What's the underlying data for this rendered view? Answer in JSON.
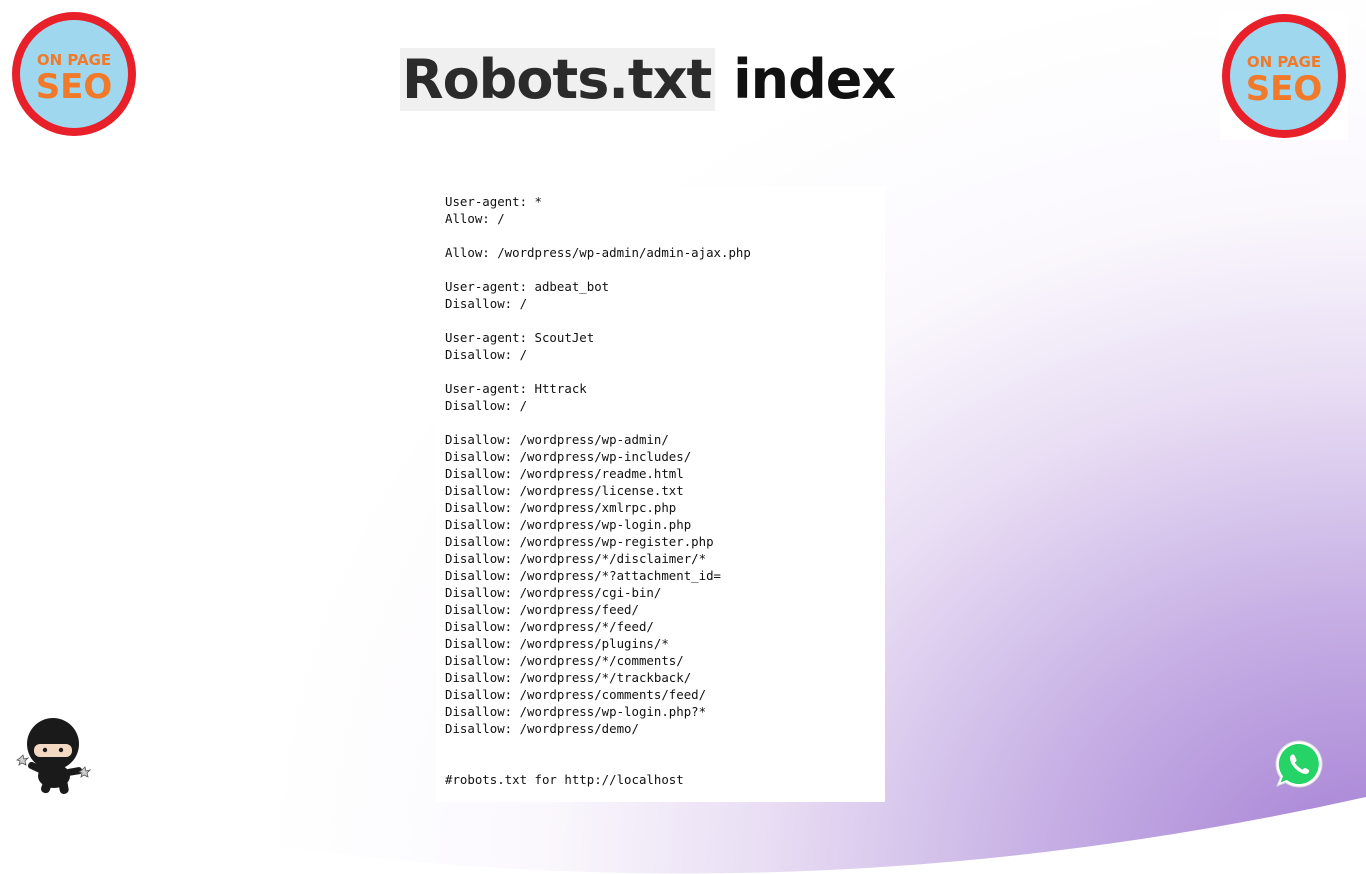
{
  "header": {
    "title_highlight": "Robots.txt",
    "title_rest": "index"
  },
  "logo": {
    "top_text": "ON PAGE",
    "bottom_text": "SEO",
    "ring_color": "#e8202a",
    "inner_color": "#9fd8ee",
    "text_color": "#f07a2a"
  },
  "robots_txt": {
    "lines": [
      "User-agent: *",
      "Allow: /",
      "",
      "Allow: /wordpress/wp-admin/admin-ajax.php",
      "",
      "User-agent: adbeat_bot",
      "Disallow: /",
      "",
      "User-agent: ScoutJet",
      "Disallow: /",
      "",
      "User-agent: Httrack",
      "Disallow: /",
      "",
      "Disallow: /wordpress/wp-admin/",
      "Disallow: /wordpress/wp-includes/",
      "Disallow: /wordpress/readme.html",
      "Disallow: /wordpress/license.txt",
      "Disallow: /wordpress/xmlrpc.php",
      "Disallow: /wordpress/wp-login.php",
      "Disallow: /wordpress/wp-register.php",
      "Disallow: /wordpress/*/disclaimer/*",
      "Disallow: /wordpress/*?attachment_id=",
      "Disallow: /wordpress/cgi-bin/",
      "Disallow: /wordpress/feed/",
      "Disallow: /wordpress/*/feed/",
      "Disallow: /wordpress/plugins/*",
      "Disallow: /wordpress/*/comments/",
      "Disallow: /wordpress/*/trackback/",
      "Disallow: /wordpress/comments/feed/",
      "Disallow: /wordpress/wp-login.php?*",
      "Disallow: /wordpress/demo/",
      "",
      "",
      "#robots.txt for http://localhost"
    ]
  },
  "icons": {
    "ninja": "ninja-mascot-icon",
    "whatsapp": "whatsapp-icon",
    "whatsapp_color": "#25d366"
  }
}
